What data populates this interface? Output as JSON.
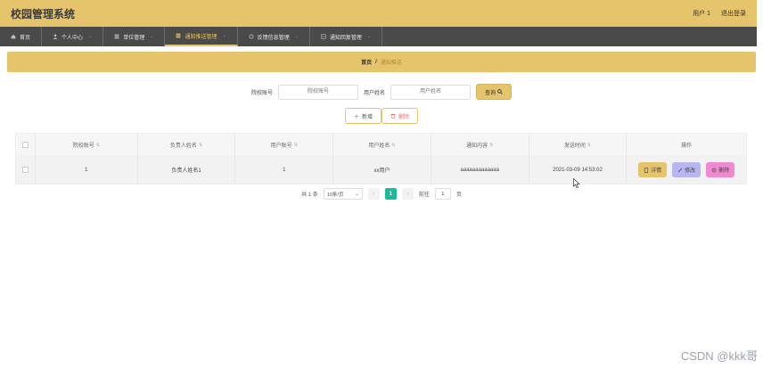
{
  "header": {
    "title": "校园管理系统",
    "user_label": "用户 1",
    "logout_label": "退出登录"
  },
  "nav": {
    "items": [
      {
        "label": "首页",
        "icon": "home-icon"
      },
      {
        "label": "个人中心",
        "icon": "user-icon"
      },
      {
        "label": "单位管理",
        "icon": "list-icon"
      },
      {
        "label": "通知推送管理",
        "icon": "list-icon",
        "active": true
      },
      {
        "label": "反馈信息管理",
        "icon": "circle-icon"
      },
      {
        "label": "通知回复管理",
        "icon": "grid-icon"
      }
    ]
  },
  "breadcrumb": {
    "home": "首页",
    "separator": "/",
    "current": "通知推送"
  },
  "search": {
    "field1_label": "院校账号",
    "field1_placeholder": "院校账号",
    "field2_label": "用户姓名",
    "field2_placeholder": "用户姓名",
    "button_label": "查询"
  },
  "actions": {
    "add_label": "新增",
    "delete_label": "删除"
  },
  "table": {
    "headers": [
      "院校账号",
      "负责人姓名",
      "用户账号",
      "用户姓名",
      "通知内容",
      "发送时间",
      "操作"
    ],
    "rows": [
      {
        "school_account": "1",
        "leader_name": "负责人姓名1",
        "user_account": "1",
        "user_name": "xx用户",
        "content": "aaaaaaaaaaaaa",
        "send_time": "2021-03-09 14:53:02"
      }
    ],
    "row_actions": {
      "detail": "详情",
      "edit": "修改",
      "delete": "删除"
    }
  },
  "pagination": {
    "total_label": "共 1 条",
    "page_size": "10条/页",
    "current_page": "1",
    "goto_label": "前往",
    "goto_value": "1",
    "page_unit": "页"
  },
  "watermark": "CSDN @kkk哥",
  "colors": {
    "accent": "#e6c46b",
    "nav_bg": "#4a4a4a",
    "page_active": "#1fb89a"
  }
}
